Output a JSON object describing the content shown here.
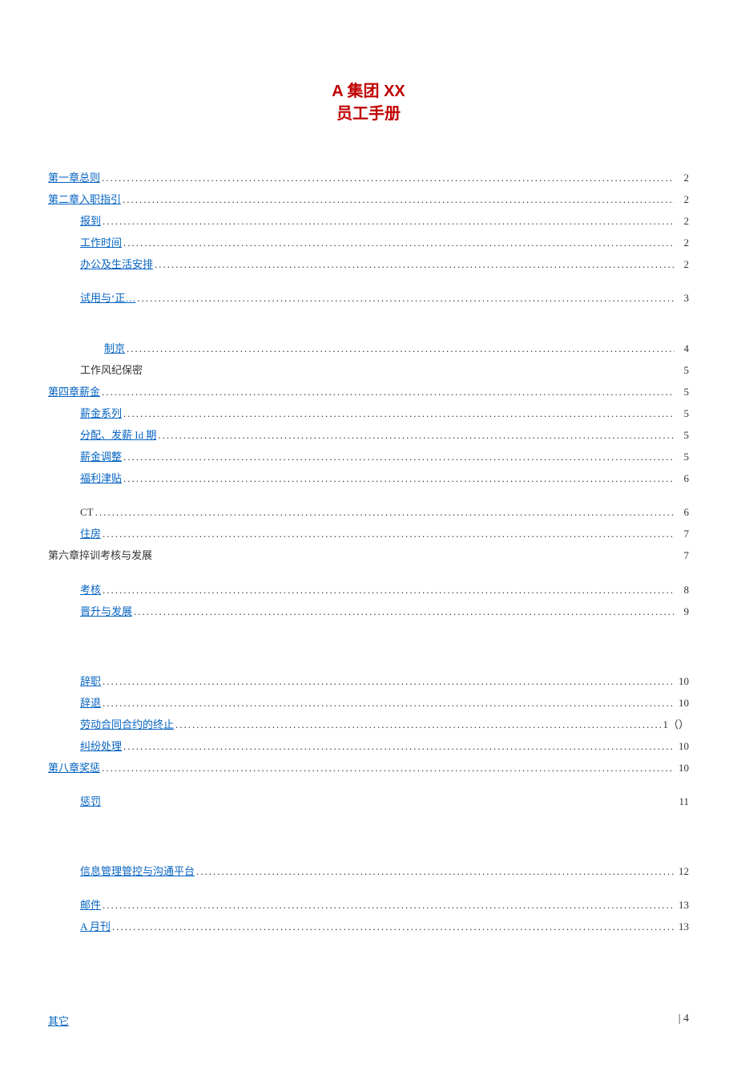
{
  "title": {
    "line1": "A 集团 XX",
    "line2": "员工手册"
  },
  "toc": [
    {
      "indent": 0,
      "label": "第一章总则",
      "link": true,
      "dots": true,
      "page": "2"
    },
    {
      "indent": 0,
      "label": "第二章入职指引",
      "link": true,
      "dots": true,
      "page": "2"
    },
    {
      "indent": 1,
      "label": "报到",
      "link": true,
      "dots": true,
      "page": "2"
    },
    {
      "indent": 1,
      "label": "工作时间",
      "link": true,
      "dots": true,
      "page": "2"
    },
    {
      "indent": 1,
      "label": "办公及生活安排",
      "link": true,
      "dots": true,
      "page": "2"
    },
    {
      "indent": 1,
      "label": "试用与‘正…",
      "link": true,
      "dots": true,
      "page": "3",
      "gapBefore": "sm"
    },
    {
      "gapBefore": "md",
      "indent": 2,
      "label": "制京",
      "link": true,
      "dots": true,
      "page": "4"
    },
    {
      "indent": 1,
      "label": "工作风纪保密",
      "link": false,
      "dots": false,
      "page": "5"
    },
    {
      "indent": 0,
      "label": "第四章薪金",
      "link": true,
      "dots": true,
      "page": "5"
    },
    {
      "indent": 1,
      "label": "薪金系列",
      "link": true,
      "dots": true,
      "page": "5"
    },
    {
      "indent": 1,
      "label": "分配、发薪 Id 期",
      "link": true,
      "dots": true,
      "page": "5"
    },
    {
      "indent": 1,
      "label": "薪金调整",
      "link": true,
      "dots": true,
      "page": "5"
    },
    {
      "indent": 1,
      "label": "福利津贴",
      "link": true,
      "dots": true,
      "page": "6"
    },
    {
      "gapBefore": "sm",
      "indent": 1,
      "label": "CT",
      "link": false,
      "dots": true,
      "page": "6"
    },
    {
      "indent": 1,
      "label": "住房",
      "link": true,
      "dots": true,
      "page": "7"
    },
    {
      "indent": 0,
      "label": "第六章捽训考核与发展",
      "link": false,
      "dots": false,
      "page": "7"
    },
    {
      "gapBefore": "sm",
      "indent": 1,
      "label": "考核",
      "link": true,
      "dots": true,
      "page": "8"
    },
    {
      "indent": 1,
      "label": "晋升与发展",
      "link": true,
      "dots": true,
      "page": "9"
    },
    {
      "gapBefore": "lg",
      "indent": 1,
      "label": "辞职",
      "link": true,
      "dots": true,
      "page": "10"
    },
    {
      "indent": 1,
      "label": "辞退",
      "link": true,
      "dots": true,
      "page": "10"
    },
    {
      "indent": 1,
      "label": "劳动合同合约的终止",
      "link": true,
      "dots": true,
      "page": "1（）"
    },
    {
      "indent": 1,
      "label": "纠纷处理",
      "link": true,
      "dots": true,
      "page": "10"
    },
    {
      "indent": 0,
      "label": "第八章奖惩",
      "link": true,
      "dots": true,
      "page": "10"
    },
    {
      "gapBefore": "sm",
      "indent": 1,
      "label": "惩罚",
      "link": true,
      "dots": false,
      "page": "11"
    },
    {
      "gapBefore": "lg",
      "indent": 1,
      "label": "信息管理管控与沟通平台",
      "link": true,
      "dots": true,
      "page": "12"
    },
    {
      "gapBefore": "sm",
      "indent": 1,
      "label": "邮件",
      "link": true,
      "dots": true,
      "page": "13"
    },
    {
      "indent": 1,
      "label": "A 月刊",
      "link": true,
      "dots": true,
      "page": "13"
    }
  ],
  "footer": {
    "left": "其它",
    "right": "| 4"
  }
}
